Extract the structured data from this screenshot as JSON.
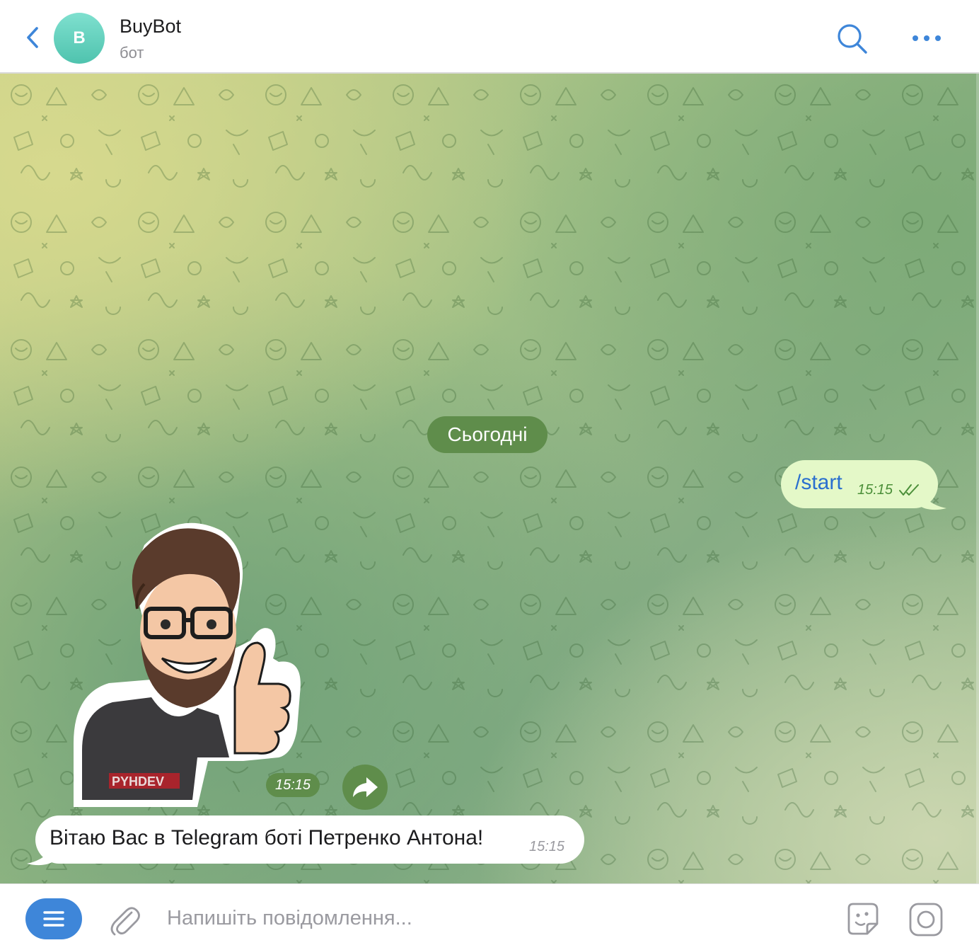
{
  "header": {
    "avatar_letter": "B",
    "title": "BuyBot",
    "subtitle": "бот",
    "back_icon": "chevron-left-icon",
    "search_icon": "search-icon",
    "more_icon": "more-dots-icon"
  },
  "chat": {
    "date_separator": "Сьогодні",
    "messages": [
      {
        "direction": "outgoing",
        "text": "/start",
        "time": "15:15",
        "status": "read"
      },
      {
        "direction": "incoming",
        "type": "sticker",
        "time": "15:15",
        "sticker_caption": "PYHDEV"
      },
      {
        "direction": "incoming",
        "text": "Вітаю Вас в Telegram боті Петренко Антона!",
        "time": "15:15"
      }
    ]
  },
  "composer": {
    "placeholder": "Напишіть повідомлення...",
    "value": "",
    "menu_icon": "menu-icon",
    "attach_icon": "paperclip-icon",
    "sticker_icon": "sticker-icon",
    "camera_icon": "camera-icon"
  },
  "colors": {
    "accent": "#3e86d9",
    "outgoing_bubble": "#e4f8c8",
    "incoming_bubble": "#ffffff",
    "pill": "#5f8d4b",
    "link_blue": "#2a6fcf",
    "read_green": "#4b8f39"
  }
}
